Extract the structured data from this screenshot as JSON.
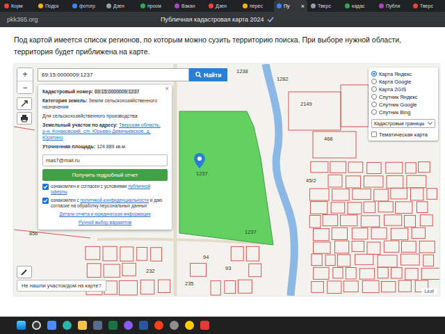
{
  "browser": {
    "tabs": [
      {
        "label": "Корм",
        "selected": false
      },
      {
        "label": "Подск",
        "selected": false
      },
      {
        "label": "фотогр",
        "selected": false
      },
      {
        "label": "Дзен",
        "selected": false
      },
      {
        "label": "просм",
        "selected": false
      },
      {
        "label": "Вакан",
        "selected": false
      },
      {
        "label": "Дзен",
        "selected": false
      },
      {
        "label": "перес",
        "selected": false
      },
      {
        "label": "Пу",
        "selected": true
      },
      {
        "label": "Тверс",
        "selected": false
      },
      {
        "label": "кадас",
        "selected": false
      },
      {
        "label": "Публи",
        "selected": false
      },
      {
        "label": "Тверс",
        "selected": false
      }
    ],
    "close_icon": "×",
    "url": "pkk365.org",
    "page_title": "Публичная кадастровая карта 2024"
  },
  "page": {
    "intro": "Под картой имеется список регионов, по которым можно сузить территорию поиска. При выборе нужной области, территория будет приближена на карте."
  },
  "map": {
    "zoom_in": "+",
    "zoom_out": "−",
    "search": {
      "value": "69:15:0000009:1237",
      "button": "Найти"
    },
    "popup": {
      "close": "×",
      "number_label": "Кадастровый номер:",
      "number_value": "69:15:0000009:1237",
      "category_label": "Категория земель:",
      "category_value": "Земли сельскохозяйственного назначения",
      "usage": "Для сельскохозяйственного производства",
      "address_label": "Земельный участок по адресу:",
      "address_value": "Тверская область, р-н. Конаковский, с/п. Юрьево-Девичьевское, д. Юрятино",
      "area_label": "Уточненная площадь:",
      "area_value": "124 889 кв.м.",
      "email": "mas7@mail.ru",
      "report_button": "Получить подробный отчет",
      "agreements": [
        {
          "before": "ознакомлен и согласен с условиями ",
          "link": "публичной оферты",
          "after": "",
          "checked": true
        },
        {
          "before": "ознакомлен с ",
          "link": "политикой конфиденциальности",
          "after": " и даю согласие на обработку персональных данных",
          "checked": true
        }
      ],
      "links": [
        "Детали отчета и юридическая информация",
        "Ручной выбор вариантов"
      ]
    },
    "layers": {
      "options": [
        {
          "label": "Карта Яндекс",
          "selected": true
        },
        {
          "label": "Карта Google",
          "selected": false
        },
        {
          "label": "Карта 2GIS",
          "selected": false
        },
        {
          "label": "Спутник Яндекс",
          "selected": false
        },
        {
          "label": "Спутник Google",
          "selected": false
        },
        {
          "label": "Спутник Bing",
          "selected": false
        }
      ],
      "select": "Кадастровые границы",
      "thematic": {
        "label": "Тематическая карта",
        "checked": false
      }
    },
    "help": "Не нашли участок/дом на карте?",
    "attribution": "Leaf",
    "parcel_labels": [
      "1238",
      "1282",
      "2149",
      "468",
      "1237",
      "1237",
      "45/2",
      "94",
      "93",
      "232",
      "235",
      "856"
    ]
  }
}
